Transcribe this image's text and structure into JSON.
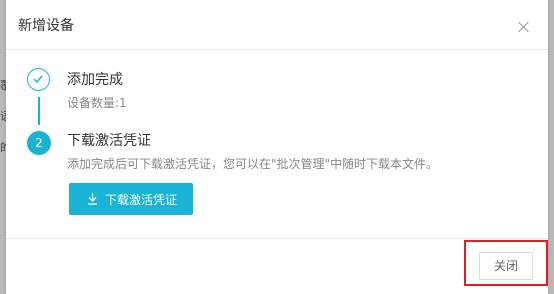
{
  "background": {
    "edge_text": [
      "覆",
      "语",
      "的"
    ]
  },
  "dialog": {
    "title": "新增设备",
    "steps": [
      {
        "status": "done",
        "icon": "check-icon",
        "title": "添加完成",
        "description": "设备数量:1"
      },
      {
        "status": "current",
        "number": "2",
        "title": "下载激活凭证",
        "description": "添加完成后可下载激活凭证，您可以在\"批次管理\"中随时下载本文件。"
      }
    ],
    "download_button_label": "下载激活凭证",
    "close_button_label": "关闭"
  },
  "colors": {
    "accent": "#19b3d6",
    "highlight_box": "#e02020",
    "overlay": "#b9b9b9"
  }
}
